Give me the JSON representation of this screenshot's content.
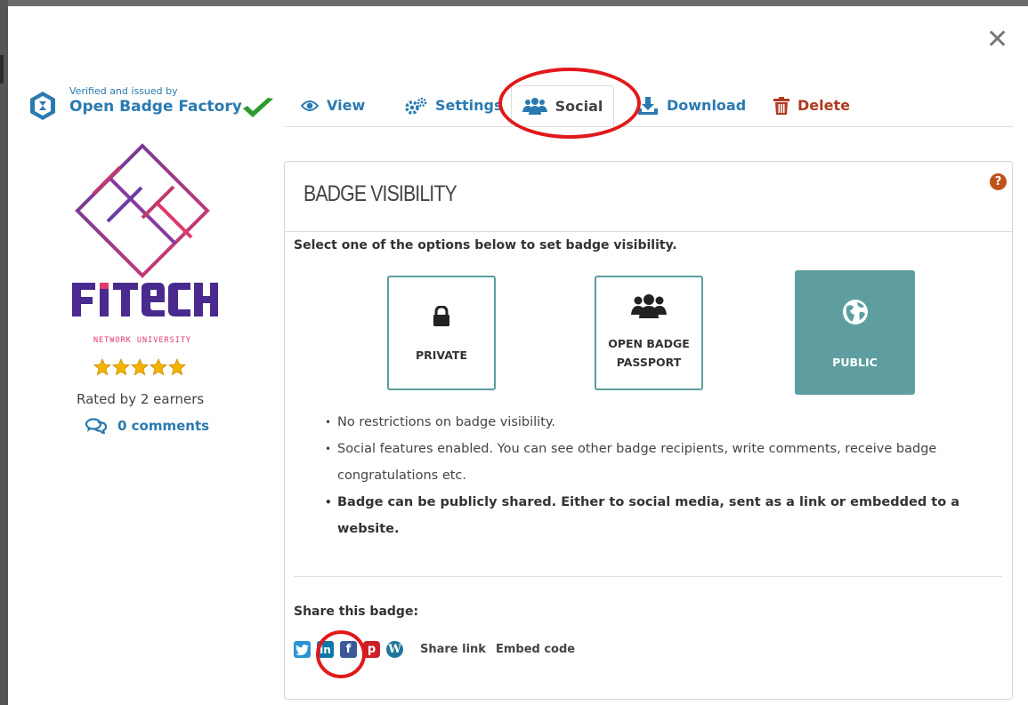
{
  "window": {
    "close_label": "✕"
  },
  "issuer": {
    "verified_text": "Verified and issued by",
    "name": "Open Badge Factory"
  },
  "tabs": [
    {
      "label": "View",
      "icon": "eye-icon"
    },
    {
      "label": "Settings",
      "icon": "gears-icon"
    },
    {
      "label": "Social",
      "icon": "users-icon",
      "active": true
    },
    {
      "label": "Download",
      "icon": "download-icon"
    },
    {
      "label": "Delete",
      "icon": "trash-icon"
    }
  ],
  "badge": {
    "rating_stars": 5,
    "rated_text": "Rated by 2 earners",
    "comments_text": "0 comments"
  },
  "visibility": {
    "title": "BADGE VISIBILITY",
    "help_label": "?",
    "instruction": "Select one of the options below to set badge visibility.",
    "options": [
      {
        "label": "PRIVATE",
        "icon": "lock-icon",
        "selected": false
      },
      {
        "label_line1": "OPEN BADGE",
        "label_line2": "PASSPORT",
        "icon": "users-icon",
        "selected": false
      },
      {
        "label": "PUBLIC",
        "icon": "globe-icon",
        "selected": true
      }
    ],
    "bullets": [
      "No restrictions on badge visibility.",
      "Social features enabled. You can see other badge recipients, write comments, receive badge congratulations etc.",
      "Badge can be publicly shared. Either to social media, sent as a link or embedded to a website."
    ]
  },
  "share": {
    "title": "Share this badge:",
    "icons": [
      "twitter-icon",
      "linkedin-icon",
      "facebook-icon",
      "pinterest-icon",
      "wordpress-icon"
    ],
    "share_link": "Share link",
    "embed_code": "Embed code"
  },
  "colors": {
    "link_blue": "#2a7ab0",
    "delete_red": "#b03a20",
    "teal": "#5e9ea0",
    "highlight_ring": "#e0191b"
  }
}
